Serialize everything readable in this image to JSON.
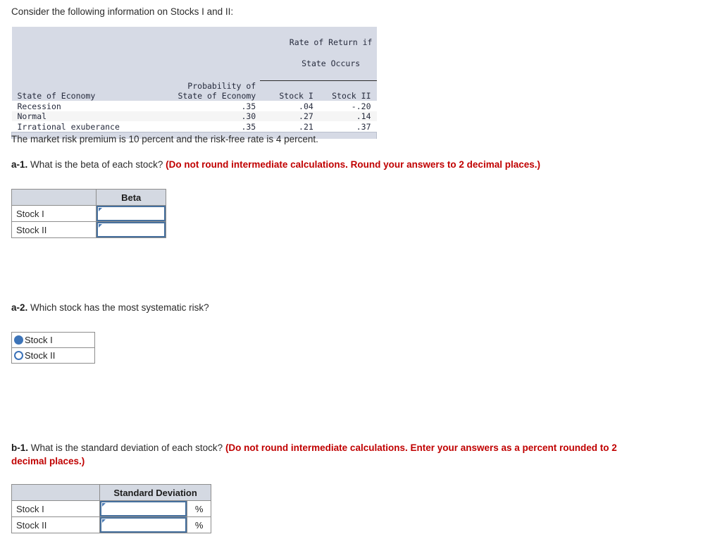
{
  "intro": "Consider the following information on Stocks I and II:",
  "data_table": {
    "group_header": [
      "Rate of Return if",
      "State Occurs"
    ],
    "col_headers": {
      "state": "State of Economy",
      "probability": [
        "Probability of",
        "State of Economy"
      ],
      "stock1": "Stock I",
      "stock2": "Stock II"
    },
    "rows": [
      {
        "state": "Recession",
        "probability": ".35",
        "stock1": ".04",
        "stock2": "-.20"
      },
      {
        "state": "Normal",
        "probability": ".30",
        "stock1": ".27",
        "stock2": ".14"
      },
      {
        "state": "Irrational exuberance",
        "probability": ".35",
        "stock1": ".21",
        "stock2": ".37"
      }
    ]
  },
  "premium_text": "The market risk premium is 10 percent and the risk-free rate is 4 percent.",
  "q_a1": {
    "label": "a-1.",
    "question": " What is the beta of each stock? ",
    "instruction": "(Do not round intermediate calculations. Round your answers to 2 decimal places.)",
    "table": {
      "blank_header": "",
      "value_header": "Beta",
      "rows": [
        {
          "label": "Stock I",
          "value": ""
        },
        {
          "label": "Stock II",
          "value": ""
        }
      ]
    }
  },
  "q_a2": {
    "label": "a-2.",
    "question": " Which stock has the most systematic risk?",
    "options": [
      {
        "label": "Stock I",
        "selected": true
      },
      {
        "label": "Stock II",
        "selected": false
      }
    ]
  },
  "q_b1": {
    "label": "b-1.",
    "question": " What is the standard deviation of each stock? ",
    "instruction": "(Do not round intermediate calculations. Enter your answers as a percent rounded to 2 decimal places.)",
    "table": {
      "blank_header": "",
      "value_header": "Standard Deviation",
      "unit": "%",
      "rows": [
        {
          "label": "Stock I",
          "value": ""
        },
        {
          "label": "Stock II",
          "value": ""
        }
      ]
    }
  },
  "colors": {
    "header_fill": "#d4d9e2",
    "mono_text": "#262b3d",
    "instruction_red": "#c00000",
    "input_border": "#46709e",
    "radio_selected": "#3d74b8"
  }
}
